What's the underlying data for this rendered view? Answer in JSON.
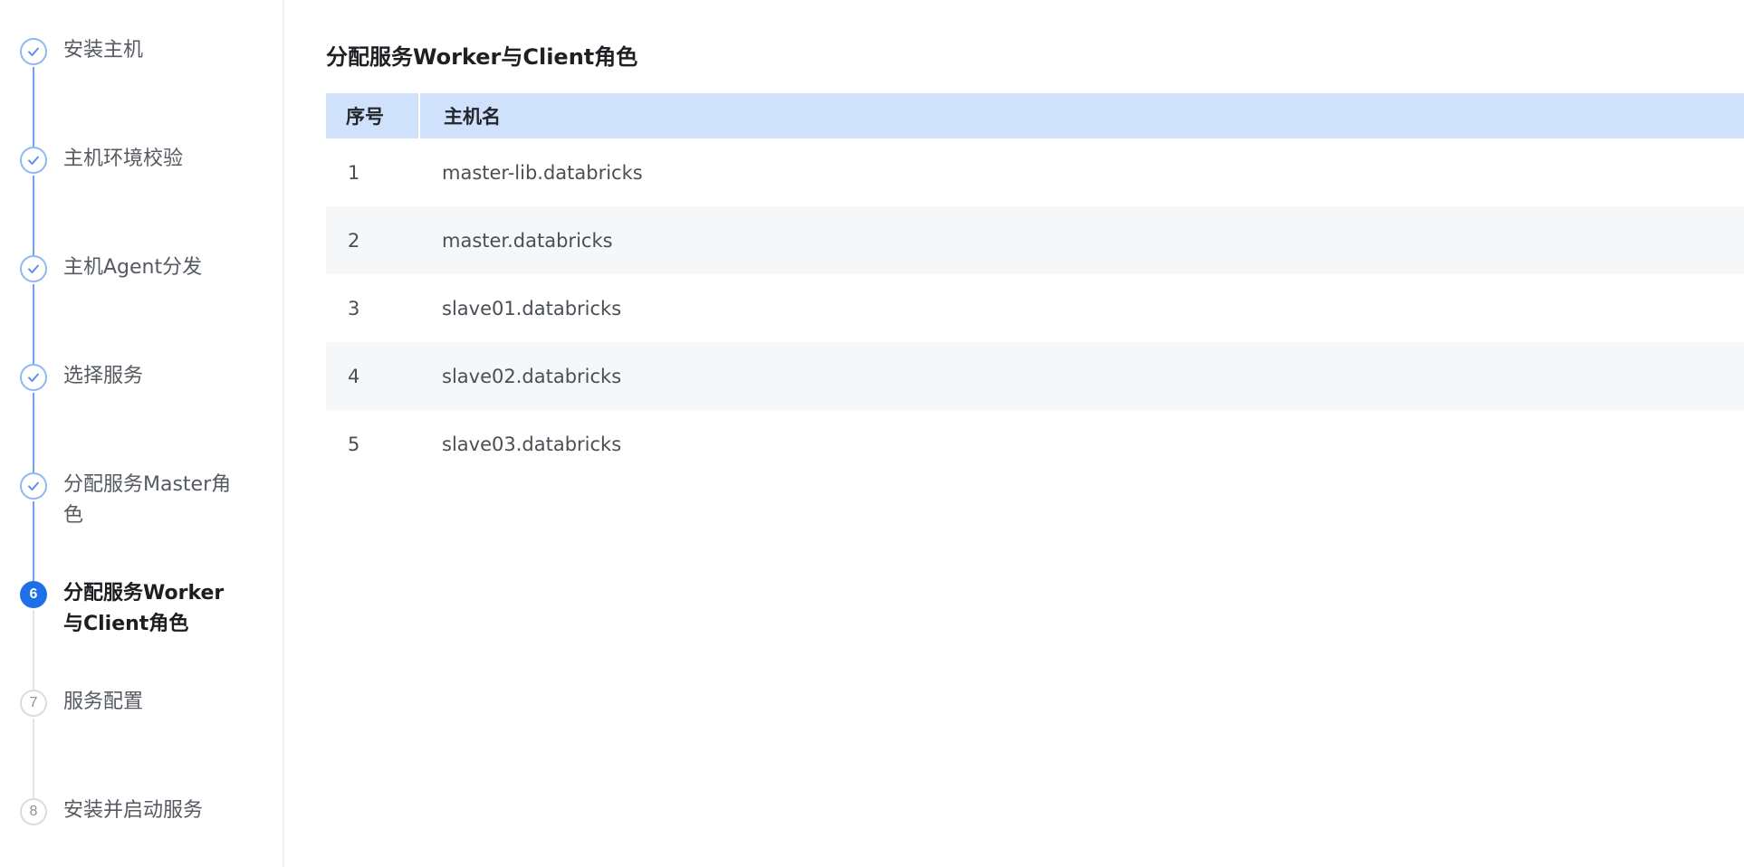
{
  "steps": [
    {
      "label": "安装主机",
      "state": "done"
    },
    {
      "label": "主机环境校验",
      "state": "done"
    },
    {
      "label": "主机Agent分发",
      "state": "done"
    },
    {
      "label": "选择服务",
      "state": "done"
    },
    {
      "label": "分配服务Master角色",
      "state": "done"
    },
    {
      "label": "分配服务Worker与Client角色",
      "state": "active",
      "number": "6"
    },
    {
      "label": "服务配置",
      "state": "todo",
      "number": "7"
    },
    {
      "label": "安装并启动服务",
      "state": "todo",
      "number": "8"
    }
  ],
  "main": {
    "title": "分配服务Worker与Client角色",
    "table": {
      "headers": [
        "序号",
        "主机名"
      ],
      "rows": [
        {
          "index": "1",
          "hostname": "master-lib.databricks"
        },
        {
          "index": "2",
          "hostname": "master.databricks"
        },
        {
          "index": "3",
          "hostname": "slave01.databricks"
        },
        {
          "index": "4",
          "hostname": "slave02.databricks"
        },
        {
          "index": "5",
          "hostname": "slave03.databricks"
        }
      ]
    }
  },
  "colors": {
    "accent": "#1f6fe6",
    "step_done_border": "#8fb8f2",
    "connector_done": "#6ea4ee",
    "connector_todo": "#e3e5e8",
    "table_header_bg": "#cfe1fb",
    "row_alt_bg": "#f6f7f9"
  }
}
